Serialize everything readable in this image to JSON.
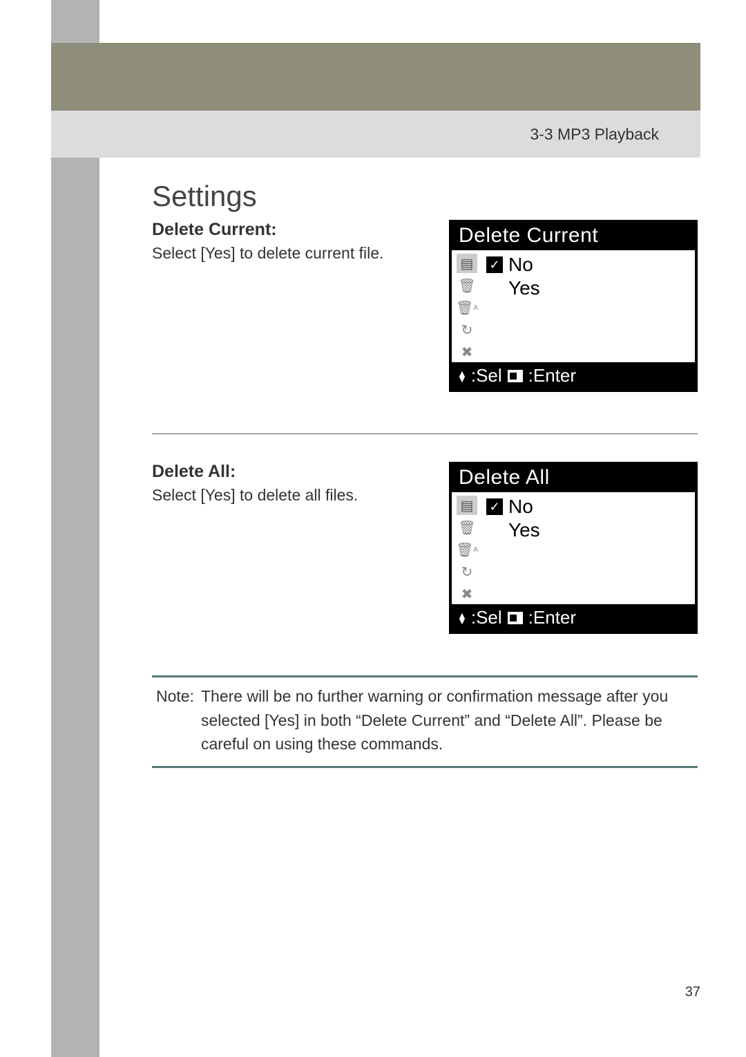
{
  "header": {
    "section": "3-3 MP3 Playback"
  },
  "title": "Settings",
  "delete_current": {
    "heading": "Delete Current:",
    "body": "Select [Yes] to delete current file.",
    "lcd": {
      "title": "Delete Current",
      "option_no": "No",
      "option_yes": "Yes",
      "footer_sel": ":Sel",
      "footer_enter": ":Enter"
    }
  },
  "delete_all": {
    "heading": "Delete All:",
    "body": "Select [Yes] to delete all files.",
    "lcd": {
      "title": "Delete All",
      "option_no": "No",
      "option_yes": "Yes",
      "footer_sel": ":Sel",
      "footer_enter": ":Enter"
    }
  },
  "note": {
    "label": "Note:",
    "text": "There will be no further warning or confirmation message after you selected [Yes] in both “Delete Current” and “Delete All”.  Please be careful on using these commands."
  },
  "page_number": "37",
  "icons": {
    "list": "☰",
    "trash": "Ὕ1",
    "trash_a": "Ὕ1",
    "repeat": "↻",
    "x": "✖",
    "check": "✓",
    "up": "▲",
    "down": "▼"
  }
}
